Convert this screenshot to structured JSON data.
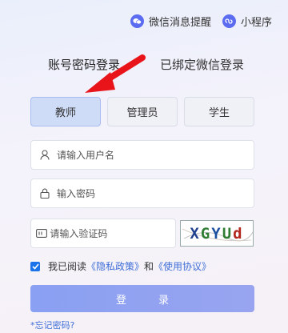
{
  "top_links": {
    "wechat_notice": "微信消息提醒",
    "mini_program": "小程序"
  },
  "tabs": {
    "account_login": "账号密码登录",
    "wechat_login": "已绑定微信登录"
  },
  "roles": [
    {
      "label": "教师",
      "selected": true
    },
    {
      "label": "管理员",
      "selected": false
    },
    {
      "label": "学生",
      "selected": false
    }
  ],
  "fields": {
    "username_placeholder": "请输入用户名",
    "password_placeholder": "输入密码",
    "captcha_placeholder": "请输入验证码",
    "captcha_text": "XGYUd"
  },
  "agreement": {
    "prefix": "我已阅读",
    "privacy": "《隐私政策》",
    "and": "和",
    "terms": "《使用协议》",
    "checked": true
  },
  "login_button": "登录",
  "forgot_password": "*忘记密码?",
  "colors": {
    "accent": "#5b6cf0",
    "link": "#3f6fd8",
    "selected_role_bg": "#cfdcf7",
    "checkbox": "#1a73e8",
    "arrow": "#e8141a"
  }
}
